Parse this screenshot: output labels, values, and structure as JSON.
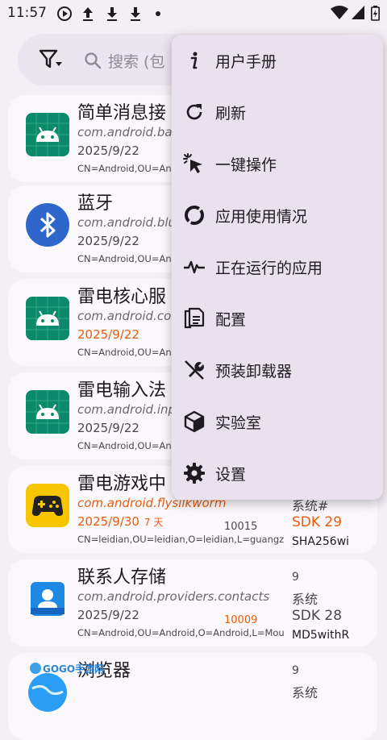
{
  "status_bar": {
    "time": "11:57",
    "icons": [
      "play-circle-icon",
      "upload-icon",
      "download-icon",
      "download-icon",
      "dot-icon",
      "wifi-icon",
      "signal-icon",
      "battery-icon"
    ]
  },
  "search": {
    "placeholder": "搜索 (包"
  },
  "apps": [
    {
      "title": "简单消息接",
      "package": "com.android.bas",
      "date": "2025/9/22",
      "cert": "CN=Android,OU=And",
      "icon": "android-icon",
      "icon_color": "#0a8a6a"
    },
    {
      "title": "蓝牙",
      "package": "com.android.blu",
      "date": "2025/9/22",
      "cert": "CN=Android,OU=And",
      "icon": "bluetooth-icon",
      "icon_color": "#2f66cc"
    },
    {
      "title": "雷电核心服",
      "package": "com.android.cor",
      "date": "2025/9/22",
      "cert": "CN=Android,OU=And",
      "icon": "android-icon",
      "icon_color": "#0a8a6a",
      "date_highlight": true
    },
    {
      "title": "雷电输入法",
      "package": "com.android.inp",
      "date": "2025/9/22",
      "cert": "CN=Android,OU=And",
      "icon": "android-icon",
      "icon_color": "#0a8a6a"
    },
    {
      "title": "雷电游戏中",
      "package": "com.android.flysilkworm",
      "date": "2025/9/30",
      "days": "7 天",
      "uid": "10015",
      "cert": "CN=leidian,OU=leidian,O=leidian,L=guangz",
      "meta": [
        "系统#",
        "SDK 29",
        "SHA256wi"
      ],
      "icon": "gamepad-icon",
      "icon_color": "#f7c600",
      "highlight": true
    },
    {
      "title": "联系人存储",
      "package": "com.android.providers.contacts",
      "date": "2025/9/22",
      "uid": "10009",
      "cert": "CN=Android,OU=Android,O=Android,L=Mou",
      "meta": [
        "9",
        "系统",
        "SDK 28",
        "MD5withR"
      ],
      "icon": "contacts-icon",
      "icon_color": "#1e88e5"
    },
    {
      "title": "浏览器",
      "meta": [
        "9",
        "系统"
      ],
      "icon": "browser-icon",
      "icon_color": "#2a9df4"
    }
  ],
  "menu": {
    "items": [
      {
        "label": "用户手册",
        "icon": "info-icon"
      },
      {
        "label": "刷新",
        "icon": "refresh-icon"
      },
      {
        "label": "一键操作",
        "icon": "tap-icon"
      },
      {
        "label": "应用使用情况",
        "icon": "donut-chart-icon"
      },
      {
        "label": "正在运行的应用",
        "icon": "pulse-icon"
      },
      {
        "label": "配置",
        "icon": "clipboard-icon"
      },
      {
        "label": "预装卸载器",
        "icon": "no-build-icon"
      },
      {
        "label": "实验室",
        "icon": "cube-icon"
      },
      {
        "label": "设置",
        "icon": "gear-icon"
      }
    ]
  },
  "watermark": {
    "text": "GOGO手游网"
  },
  "colors": {
    "accent_orange": "#e85d0c",
    "menu_bg": "#e9e2ee",
    "card_bg": "#fbf8fc"
  }
}
